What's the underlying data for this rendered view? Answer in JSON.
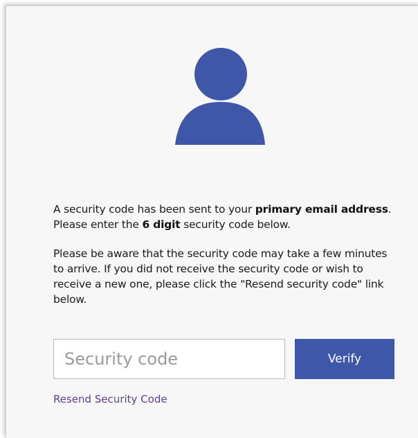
{
  "colors": {
    "accent": "#3f57a8",
    "link": "#5b3f8f",
    "panel_background": "#f7f7f7"
  },
  "avatar": {
    "icon": "user-icon"
  },
  "message": {
    "p1": {
      "t1": "A security code has been sent to your ",
      "b1": "primary email address",
      "t2": ". Please enter the ",
      "b2": "6 digit",
      "t3": " security code below."
    },
    "p2": "Please be aware that the security code may take a few minutes to arrive. If you did not receive the security code or wish to receive a new one, please click the \"Resend security code\" link below."
  },
  "form": {
    "code_placeholder": "Security code",
    "verify_label": "Verify",
    "resend_label": "Resend Security Code"
  }
}
